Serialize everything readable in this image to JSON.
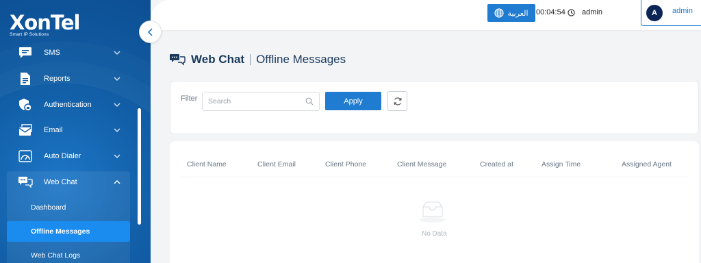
{
  "brand": {
    "name": "XonTel",
    "tagline": "Smart IP Solutions"
  },
  "sidebar": {
    "items": [
      {
        "label": "SMS",
        "icon": "sms-icon"
      },
      {
        "label": "Reports",
        "icon": "report-icon"
      },
      {
        "label": "Authentication",
        "icon": "authentication-icon"
      },
      {
        "label": "Email",
        "icon": "email-icon"
      },
      {
        "label": "Auto Dialer",
        "icon": "auto-dialer-icon"
      },
      {
        "label": "Web Chat",
        "icon": "web-chat-icon"
      }
    ],
    "submenu": [
      {
        "label": "Dashboard"
      },
      {
        "label": "Offline Messages",
        "active": true
      },
      {
        "label": "Web Chat Logs"
      }
    ]
  },
  "topbar": {
    "language_label": "العربية",
    "session_timer": "00:04:54",
    "username": "admin",
    "avatar_initial": "A",
    "user_menu_label": "admin"
  },
  "page": {
    "title": "Web Chat",
    "subtitle": "Offline Messages"
  },
  "filter": {
    "label": "Filter",
    "search_placeholder": "Search",
    "apply_label": "Apply"
  },
  "table": {
    "columns": [
      "Client Name",
      "Client Email",
      "Client Phone",
      "Client Message",
      "Created at",
      "Assign Time",
      "Assigned Agent"
    ],
    "rows": [],
    "empty_text": "No Data"
  },
  "colors": {
    "sidebar_bg": "#125fa8",
    "accent": "#1f7cd0",
    "active_item": "#1a8cf0",
    "title_text": "#1c3a5c"
  }
}
